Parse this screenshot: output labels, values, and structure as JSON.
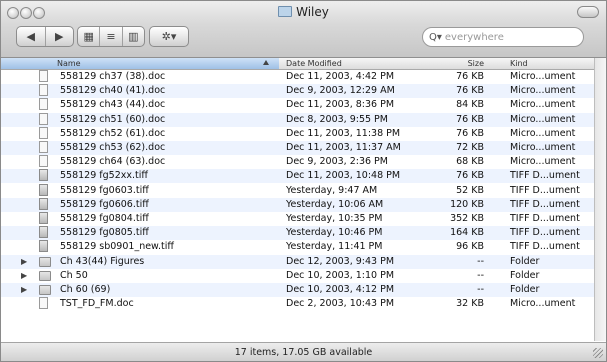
{
  "window": {
    "title": "Wiley"
  },
  "toolbar": {
    "back": "◀",
    "forward": "▶",
    "view_icon": "▦",
    "view_list": "≡",
    "view_columns": "▥",
    "action_label": "✲▾"
  },
  "search": {
    "placeholder": "everywhere",
    "icon": "Q▾"
  },
  "columns": {
    "name": "Name",
    "date": "Date Modified",
    "size": "Size",
    "kind": "Kind"
  },
  "files": [
    {
      "type": "doc",
      "name": "558129 ch37 (38).doc",
      "date": "Dec 11, 2003, 4:42 PM",
      "size": "76 KB",
      "kind": "Micro...ument"
    },
    {
      "type": "doc",
      "name": "558129 ch40 (41).doc",
      "date": "Dec 9, 2003, 12:29 AM",
      "size": "76 KB",
      "kind": "Micro...ument"
    },
    {
      "type": "doc",
      "name": "558129 ch43 (44).doc",
      "date": "Dec 11, 2003, 8:36 PM",
      "size": "84 KB",
      "kind": "Micro...ument"
    },
    {
      "type": "doc",
      "name": "558129 ch51 (60).doc",
      "date": "Dec 8, 2003, 9:55 PM",
      "size": "76 KB",
      "kind": "Micro...ument"
    },
    {
      "type": "doc",
      "name": "558129 ch52 (61).doc",
      "date": "Dec 11, 2003, 11:38 PM",
      "size": "76 KB",
      "kind": "Micro...ument"
    },
    {
      "type": "doc",
      "name": "558129 ch53 (62).doc",
      "date": "Dec 11, 2003, 11:37 AM",
      "size": "72 KB",
      "kind": "Micro...ument"
    },
    {
      "type": "doc",
      "name": "558129 ch64 (63).doc",
      "date": "Dec 9, 2003, 2:36 PM",
      "size": "68 KB",
      "kind": "Micro...ument"
    },
    {
      "type": "tiff",
      "name": "558129 fg52xx.tiff",
      "date": "Dec 11, 2003, 10:48 PM",
      "size": "76 KB",
      "kind": "TIFF D...ument"
    },
    {
      "type": "tiff",
      "name": "558129 fg0603.tiff",
      "date": "Yesterday, 9:47 AM",
      "size": "52 KB",
      "kind": "TIFF D...ument"
    },
    {
      "type": "tiff",
      "name": "558129 fg0606.tiff",
      "date": "Yesterday, 10:06 AM",
      "size": "120 KB",
      "kind": "TIFF D...ument"
    },
    {
      "type": "tiff",
      "name": "558129 fg0804.tiff",
      "date": "Yesterday, 10:35 PM",
      "size": "352 KB",
      "kind": "TIFF D...ument"
    },
    {
      "type": "tiff",
      "name": "558129 fg0805.tiff",
      "date": "Yesterday, 10:46 PM",
      "size": "164 KB",
      "kind": "TIFF D...ument"
    },
    {
      "type": "tiff",
      "name": "558129 sb0901_new.tiff",
      "date": "Yesterday, 11:41 PM",
      "size": "96 KB",
      "kind": "TIFF D...ument"
    },
    {
      "type": "folder",
      "name": "Ch 43(44) Figures",
      "date": "Dec 12, 2003, 9:43 PM",
      "size": "--",
      "kind": "Folder",
      "disclosure": "▶"
    },
    {
      "type": "folder",
      "name": "Ch 50",
      "date": "Dec 10, 2003, 1:10 PM",
      "size": "--",
      "kind": "Folder",
      "disclosure": "▶"
    },
    {
      "type": "folder",
      "name": "Ch 60 (69)",
      "date": "Dec 10, 2003, 4:12 PM",
      "size": "--",
      "kind": "Folder",
      "disclosure": "▶"
    },
    {
      "type": "doc",
      "name": "TST_FD_FM.doc",
      "date": "Dec 2, 2003, 10:43 PM",
      "size": "32 KB",
      "kind": "Micro...ument"
    }
  ],
  "status": {
    "text": "17 items, 17.05 GB available"
  }
}
